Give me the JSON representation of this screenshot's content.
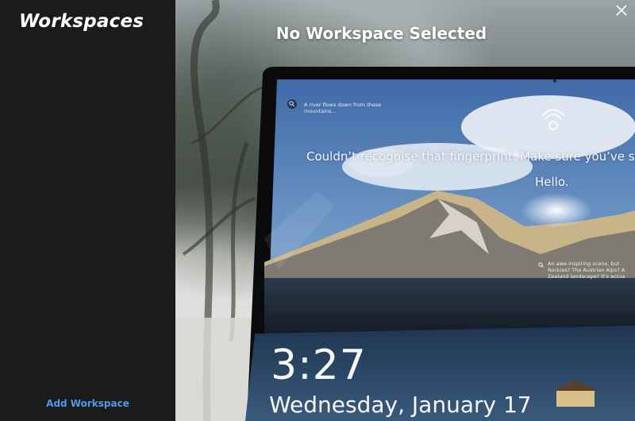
{
  "sidebar": {
    "title": "Workspaces",
    "add_workspace_label": "Add Workspace"
  },
  "main": {
    "title": "No Workspace Selected",
    "close_icon": "close-icon"
  },
  "lock_screen": {
    "caption": "A river flows down from these mountains...",
    "fingerprint_message_line1": "Couldn’t recognise that fingerprint. Make sure you’ve set u",
    "fingerprint_message_line2": "Hello.",
    "spotlight_question_line1": "An awe-inspiring scene, but",
    "spotlight_question_line2": "Rockies? The Austrian Alps? A",
    "spotlight_question_line3": "Zealand landscape? It’s actua",
    "time": "3:27",
    "date": "Wednesday, January 17"
  },
  "colors": {
    "sidebar_bg": "#1b1b1b",
    "accent": "#4a9be8",
    "title_text": "#ffffff"
  }
}
